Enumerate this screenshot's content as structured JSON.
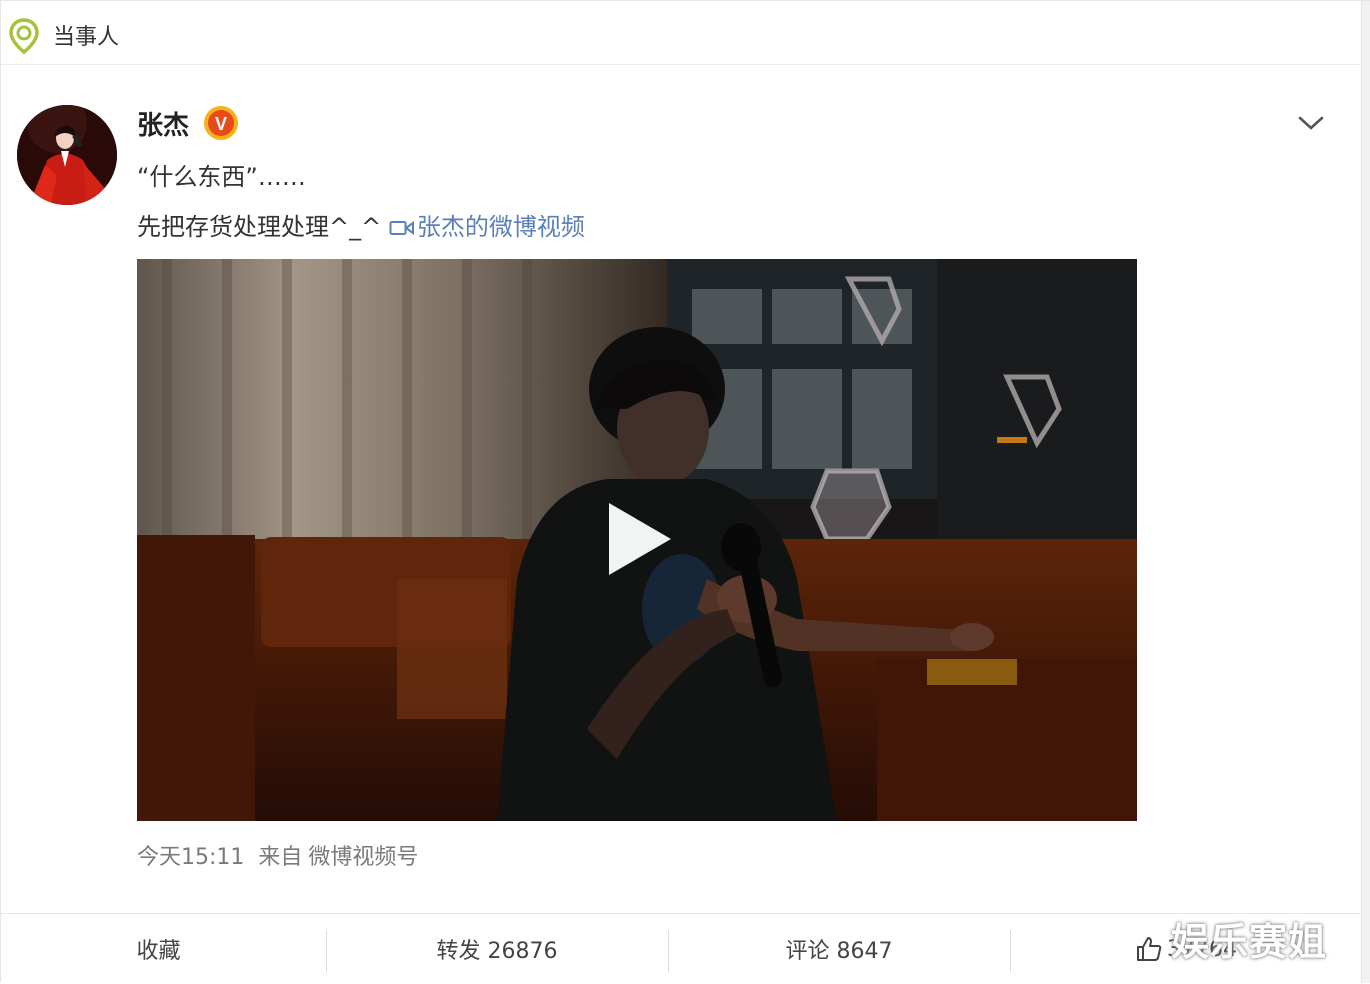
{
  "header": {
    "title": "当事人",
    "icon": "location-pin-icon"
  },
  "post": {
    "username": "张杰",
    "badge": "V",
    "text_line1": "“什么东西”……",
    "text_line2": "先把存货处理处理^_^ ",
    "video_link": "张杰的微博视频",
    "meta": {
      "time": "今天15:11",
      "from_label": "来自",
      "source": "微博视频号"
    }
  },
  "actions": {
    "favorite": "收藏",
    "repost": "转发 26876",
    "comment": "评论 8647",
    "like": "37764"
  },
  "watermark": "娱乐赛姐",
  "colors": {
    "accent": "#5b7fb8",
    "badge": "#e84a1a",
    "location_icon": "#a6c23a"
  }
}
